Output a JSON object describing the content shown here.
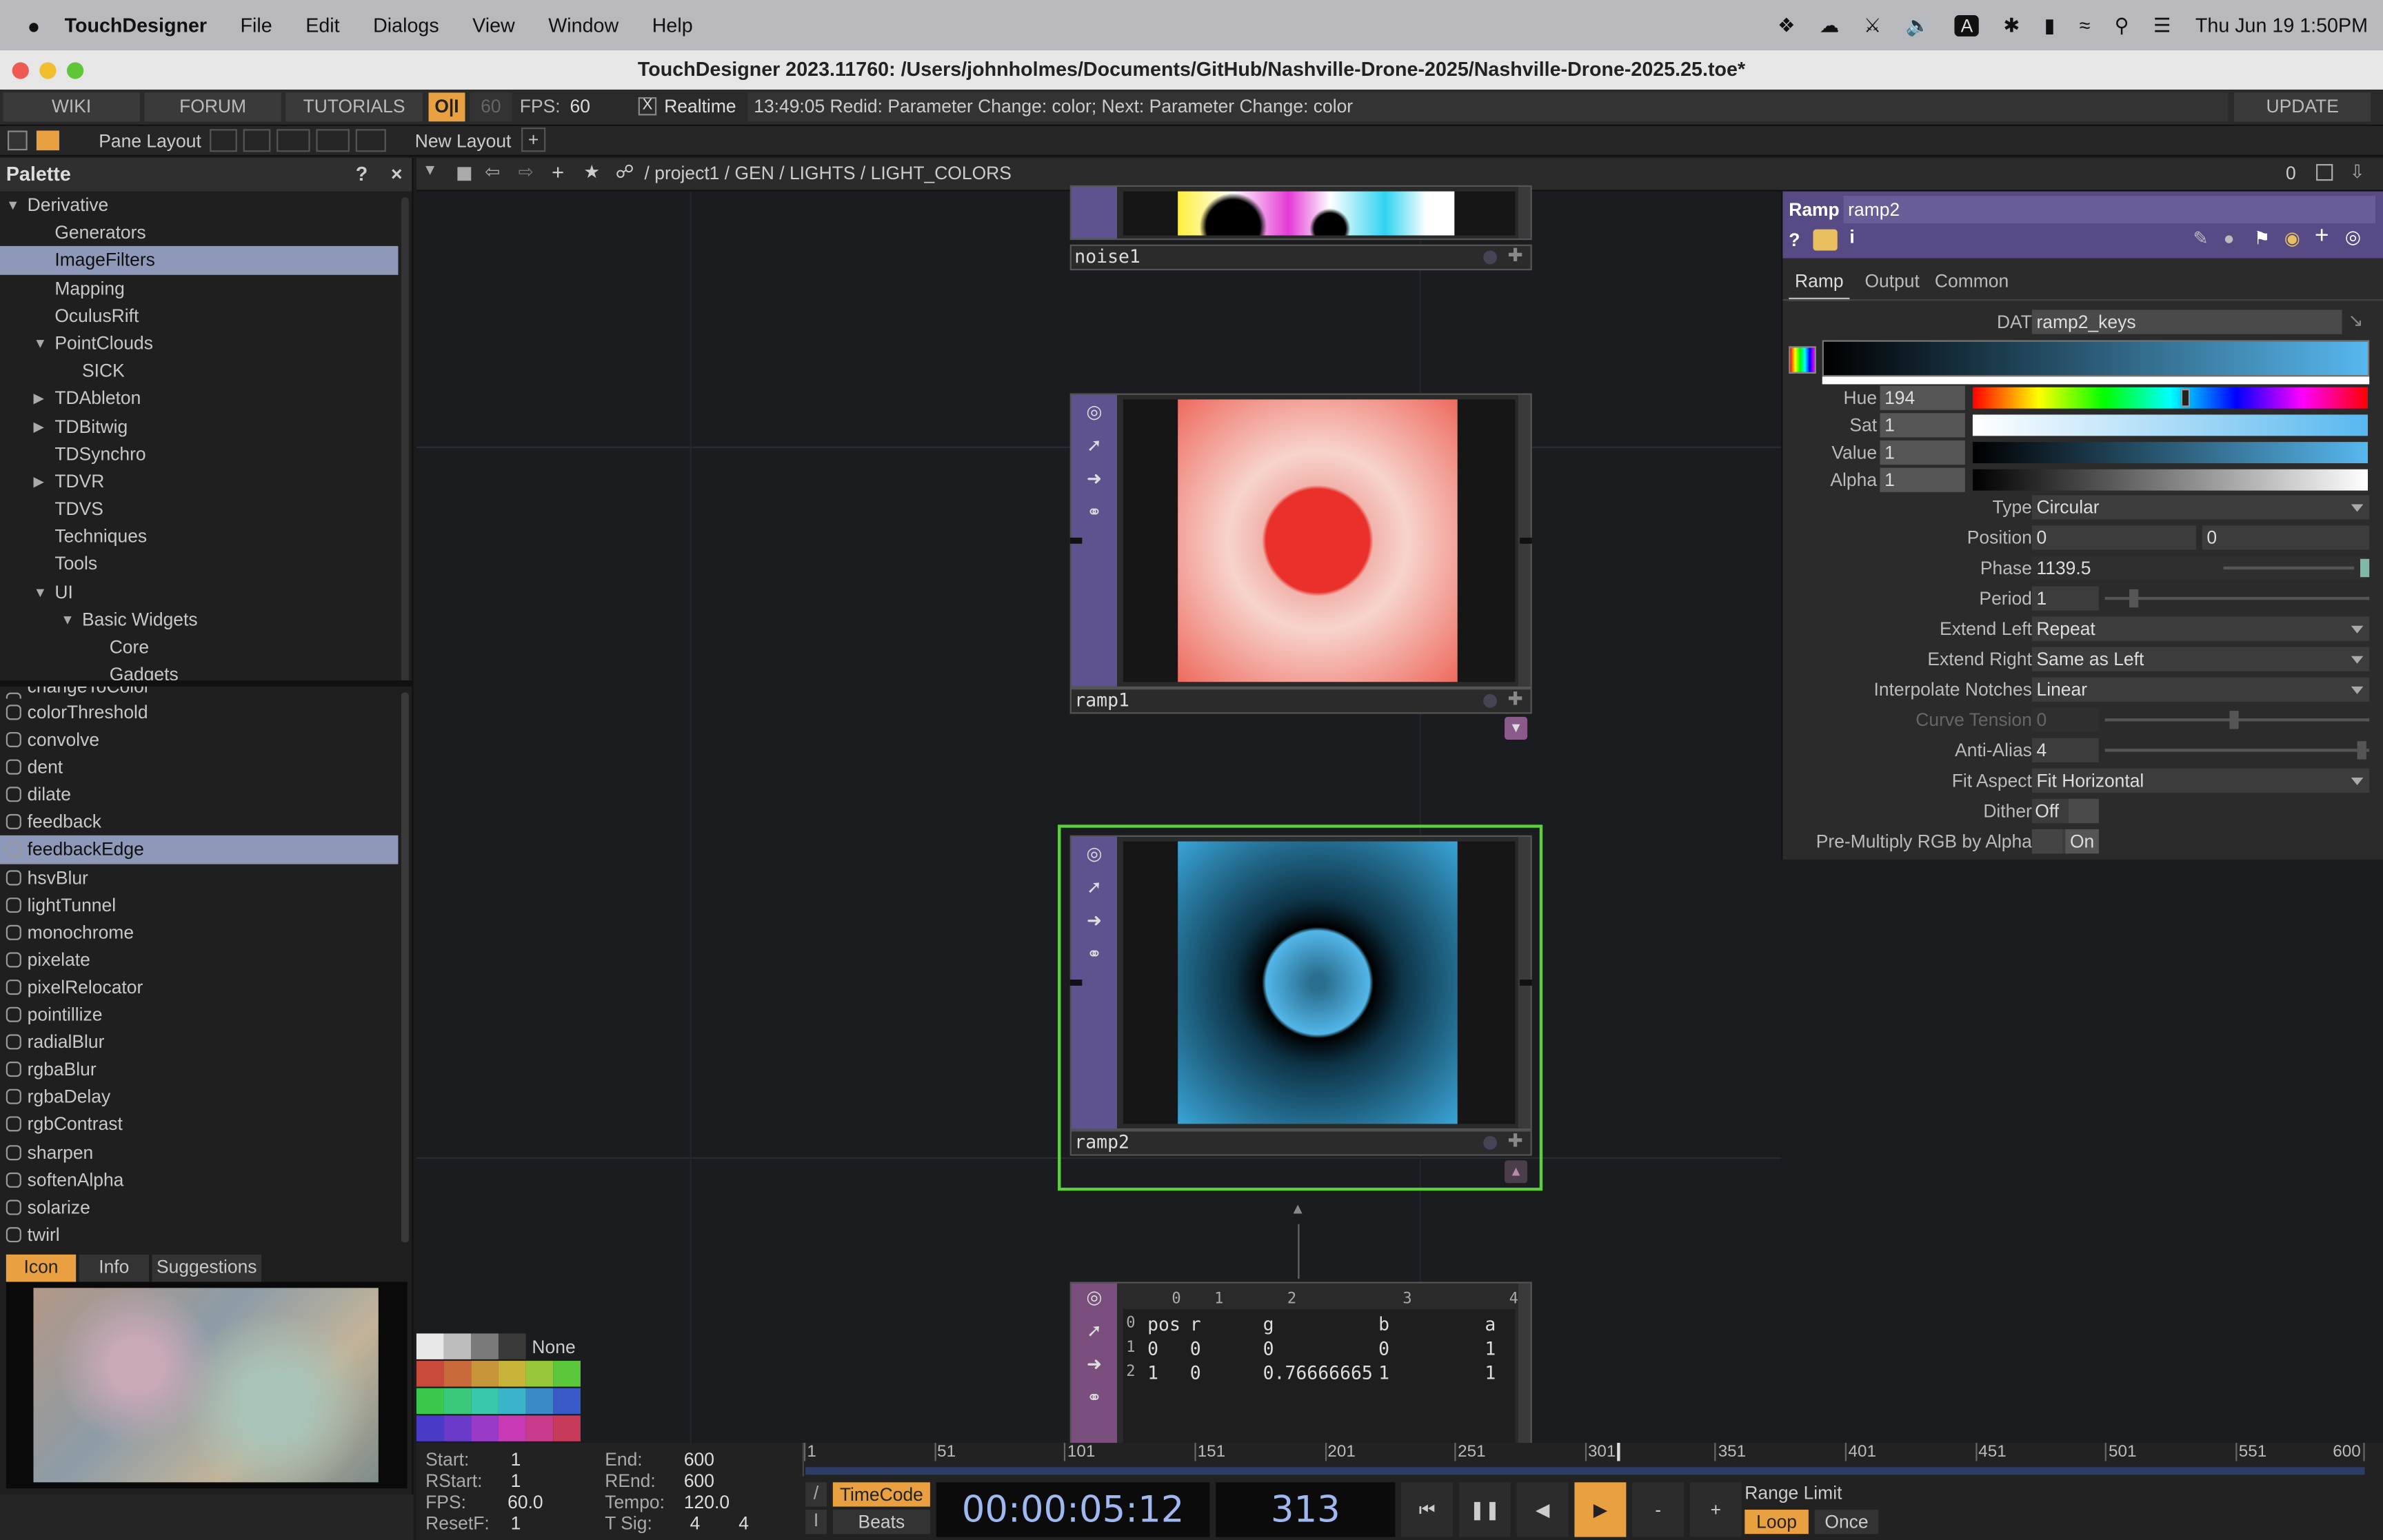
{
  "menubar": {
    "app": "TouchDesigner",
    "items": [
      "File",
      "Edit",
      "Dialogs",
      "View",
      "Window",
      "Help"
    ],
    "input": "A",
    "datetime": "Thu Jun 19  1:50PM"
  },
  "window": {
    "title": "TouchDesigner 2023.11760: /Users/johnholmes/Documents/GitHub/Nashville-Drone-2025/Nashville-Drone-2025.25.toe*"
  },
  "toolbar": {
    "wiki": "WIKI",
    "forum": "FORUM",
    "tutorials": "TUTORIALS",
    "oi": "O|I",
    "fps_cap": "60",
    "fps_label": "FPS:",
    "fps_value": "60",
    "realtime_check": "X",
    "realtime": "Realtime",
    "status": "13:49:05 Redid: Parameter Change: color; Next: Parameter Change: color",
    "update": "UPDATE"
  },
  "layout": {
    "pane_layout": "Pane Layout",
    "new_layout": "New Layout",
    "plus": "+"
  },
  "path": {
    "root": "/",
    "segments": [
      "project1",
      "GEN",
      "LIGHTS",
      "LIGHT_COLORS"
    ],
    "sep": "/",
    "counter": "0"
  },
  "palette": {
    "title": "Palette",
    "help": "?",
    "close": "×",
    "tree": [
      {
        "label": "Derivative",
        "indent": 0,
        "toggle": "open"
      },
      {
        "label": "Generators",
        "indent": 1,
        "toggle": ""
      },
      {
        "label": "ImageFilters",
        "indent": 1,
        "toggle": "",
        "selected": true
      },
      {
        "label": "Mapping",
        "indent": 1,
        "toggle": ""
      },
      {
        "label": "OculusRift",
        "indent": 1,
        "toggle": ""
      },
      {
        "label": "PointClouds",
        "indent": 1,
        "toggle": "open"
      },
      {
        "label": "SICK",
        "indent": 2,
        "toggle": ""
      },
      {
        "label": "TDAbleton",
        "indent": 1,
        "toggle": "closed"
      },
      {
        "label": "TDBitwig",
        "indent": 1,
        "toggle": "closed"
      },
      {
        "label": "TDSynchro",
        "indent": 1,
        "toggle": ""
      },
      {
        "label": "TDVR",
        "indent": 1,
        "toggle": "closed"
      },
      {
        "label": "TDVS",
        "indent": 1,
        "toggle": ""
      },
      {
        "label": "Techniques",
        "indent": 1,
        "toggle": ""
      },
      {
        "label": "Tools",
        "indent": 1,
        "toggle": ""
      },
      {
        "label": "UI",
        "indent": 1,
        "toggle": "open"
      },
      {
        "label": "Basic Widgets",
        "indent": 2,
        "toggle": "open"
      },
      {
        "label": "Core",
        "indent": 3,
        "toggle": ""
      },
      {
        "label": "Gadgets",
        "indent": 3,
        "toggle": ""
      }
    ],
    "list": [
      "changeToColor",
      "colorThreshold",
      "convolve",
      "dent",
      "dilate",
      "feedback",
      "feedbackEdge",
      "hsvBlur",
      "lightTunnel",
      "monochrome",
      "pixelate",
      "pixelRelocator",
      "pointillize",
      "radialBlur",
      "rgbaBlur",
      "rgbaDelay",
      "rgbContrast",
      "sharpen",
      "softenAlpha",
      "solarize",
      "twirl"
    ],
    "list_selected": "feedbackEdge",
    "tabs": [
      "Icon",
      "Info",
      "Suggestions"
    ]
  },
  "nodes": {
    "noise": "noise1",
    "ramp1": "ramp1",
    "ramp2": "ramp2"
  },
  "table": {
    "cols": [
      "0",
      "1",
      "2",
      "3",
      "4"
    ],
    "rows": [
      [
        "0",
        "pos",
        "r",
        "g",
        "b",
        "a"
      ],
      [
        "1",
        "0",
        "0",
        "0",
        "0",
        "1"
      ],
      [
        "2",
        "1",
        "0",
        "0.76666665",
        "1",
        "1"
      ]
    ]
  },
  "swatches": {
    "none": "None"
  },
  "params": {
    "type_label": "Ramp",
    "name": "ramp2",
    "tabs": [
      "Ramp",
      "Output",
      "Common"
    ],
    "dat_label": "DAT",
    "dat": "ramp2_keys",
    "hue_label": "Hue",
    "hue": "194",
    "sat_label": "Sat",
    "sat": "1",
    "value_label": "Value",
    "value": "1",
    "alpha_label": "Alpha",
    "alpha": "1",
    "rows": [
      {
        "label": "Type",
        "value": "Circular",
        "kind": "drop"
      },
      {
        "label": "Position",
        "value": "0",
        "value2": "0",
        "kind": "pair"
      },
      {
        "label": "Phase",
        "value": "1139.5",
        "kind": "slider"
      },
      {
        "label": "Period",
        "value": "1",
        "kind": "slider"
      },
      {
        "label": "Extend Left",
        "value": "Repeat",
        "kind": "drop"
      },
      {
        "label": "Extend Right",
        "value": "Same as Left",
        "kind": "drop"
      },
      {
        "label": "Interpolate Notches",
        "value": "Linear",
        "kind": "drop"
      },
      {
        "label": "Curve Tension",
        "value": "0",
        "kind": "slider",
        "disabled": true
      },
      {
        "label": "Anti-Alias",
        "value": "4",
        "kind": "slider"
      },
      {
        "label": "Fit Aspect",
        "value": "Fit Horizontal",
        "kind": "drop"
      },
      {
        "label": "Dither",
        "value": "Off",
        "kind": "toggle"
      },
      {
        "label": "Pre-Multiply RGB by Alpha",
        "value": "On",
        "kind": "toggle"
      }
    ]
  },
  "timeline": {
    "start_label": "Start:",
    "start": "1",
    "end_label": "End:",
    "end": "600",
    "rstart_label": "RStart:",
    "rstart": "1",
    "rend_label": "REnd:",
    "rend": "600",
    "fps_label": "FPS:",
    "fps": "60.0",
    "tempo_label": "Tempo:",
    "tempo": "120.0",
    "resetf_label": "ResetF:",
    "resetf": "1",
    "tsig_label": "T Sig:",
    "tsig1": "4",
    "tsig2": "4",
    "ticks": [
      "1",
      "51",
      "101",
      "151",
      "201",
      "251",
      "301",
      "351",
      "401",
      "451",
      "501",
      "551",
      "600"
    ],
    "timecode_btn": "TimeCode",
    "beats_btn": "Beats",
    "timecode": "00:00:05:12",
    "frame": "313",
    "minus": "-",
    "plus": "+",
    "range_limit": "Range Limit",
    "loop": "Loop",
    "once": "Once",
    "slash": "/",
    "tick_i": "I"
  },
  "colors": {
    "accent": "#e8a040",
    "select": "#8e98b8",
    "node_strip": "#5e528f",
    "selected_border": "#5ccf3a"
  }
}
